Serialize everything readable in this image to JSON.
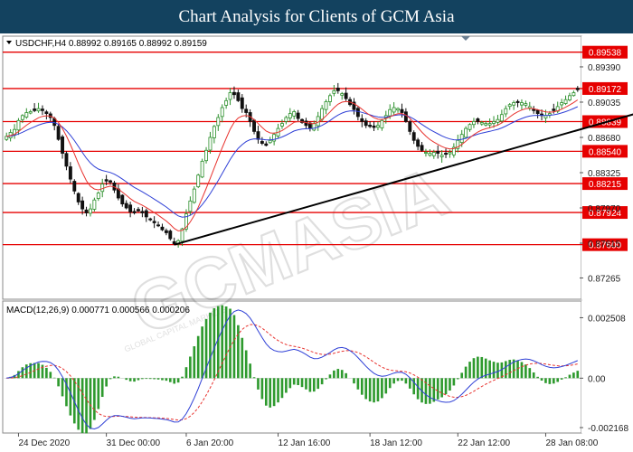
{
  "header": {
    "title": "Chart Analysis for Clients of GCM Asia"
  },
  "watermark": {
    "text": "GCMASIA",
    "subtext": "GLOBAL CAPITAL MARKETS"
  },
  "colors": {
    "title_bg": "#13425f",
    "bull": "#2b8f2b",
    "bear": "#111111",
    "level": "#e60000",
    "ma_red": "#e8332f",
    "ma_blue": "#2e3fd6",
    "trendline": "#000000",
    "macd_hist": "#2e9a2e",
    "macd_signal": "#e8332f",
    "macd_line": "#2e3fd6"
  },
  "chart_data": [
    {
      "type": "candlestick",
      "symbol_header": "USDCHF,H4  0.88992 0.89165 0.88992 0.89159",
      "ylim": [
        0.8706,
        0.8969
      ],
      "price_ticks": [
        "0.89390",
        "0.89035",
        "0.88680",
        "0.88325",
        "0.87970",
        "0.87615",
        "0.87265"
      ],
      "price_tick_values": [
        0.8939,
        0.89035,
        0.8868,
        0.88325,
        0.8797,
        0.87615,
        0.87265
      ],
      "levels": [
        {
          "label": "0.89538",
          "value": 0.89538
        },
        {
          "label": "0.89172",
          "value": 0.89172
        },
        {
          "label": "0.88839",
          "value": 0.88839
        },
        {
          "label": "0.88540",
          "value": 0.8854
        },
        {
          "label": "0.88215",
          "value": 0.88215
        },
        {
          "label": "0.87924",
          "value": 0.87924
        },
        {
          "label": "0.87600",
          "value": 0.876
        }
      ],
      "x_ticks": [
        "24 Dec 2020",
        "31 Dec 00:00",
        "6 Jan 20:00",
        "12 Jan 16:00",
        "18 Jan 12:00",
        "22 Jan 12:00",
        "28 Jan 08:00"
      ],
      "x_tick_index": [
        3,
        25,
        45,
        68,
        91,
        113,
        135
      ],
      "trendline": {
        "from": {
          "index": 42,
          "value": 0.876
        },
        "to": {
          "index": 162,
          "value": 0.8897
        }
      },
      "series": [
        {
          "name": "",
          "type": "candles",
          "close": [
            0.8869,
            0.8873,
            0.8876,
            0.8885,
            0.889,
            0.8893,
            0.8894,
            0.8895,
            0.8897,
            0.8895,
            0.8892,
            0.8888,
            0.888,
            0.8866,
            0.8852,
            0.8839,
            0.8826,
            0.8814,
            0.8803,
            0.8796,
            0.8792,
            0.8796,
            0.8805,
            0.8812,
            0.8821,
            0.8824,
            0.8823,
            0.8815,
            0.8807,
            0.8801,
            0.8797,
            0.8793,
            0.8792,
            0.8794,
            0.8792,
            0.8788,
            0.8785,
            0.8782,
            0.8779,
            0.8775,
            0.8772,
            0.8766,
            0.8761,
            0.8764,
            0.8776,
            0.8791,
            0.8804,
            0.8816,
            0.883,
            0.8844,
            0.8855,
            0.8868,
            0.8879,
            0.8888,
            0.8898,
            0.8905,
            0.8913,
            0.8911,
            0.8905,
            0.8897,
            0.8893,
            0.8884,
            0.8874,
            0.8866,
            0.8862,
            0.886,
            0.8865,
            0.8871,
            0.8877,
            0.8882,
            0.8888,
            0.8892,
            0.8894,
            0.8887,
            0.8883,
            0.888,
            0.8877,
            0.8882,
            0.8889,
            0.8897,
            0.8904,
            0.891,
            0.8915,
            0.8915,
            0.8912,
            0.8907,
            0.8901,
            0.8896,
            0.8889,
            0.8884,
            0.888,
            0.8879,
            0.8878,
            0.888,
            0.8885,
            0.889,
            0.8896,
            0.8898,
            0.8897,
            0.8893,
            0.8884,
            0.8874,
            0.8865,
            0.8859,
            0.8855,
            0.8853,
            0.8852,
            0.8853,
            0.8852,
            0.885,
            0.8851,
            0.8853,
            0.8858,
            0.8865,
            0.8871,
            0.8877,
            0.8881,
            0.8884,
            0.8884,
            0.8883,
            0.8882,
            0.8882,
            0.8884,
            0.8886,
            0.8891,
            0.8897,
            0.8901,
            0.8903,
            0.8903,
            0.8903,
            0.8902,
            0.8899,
            0.8895,
            0.8892,
            0.889,
            0.889,
            0.8892,
            0.8895,
            0.8899,
            0.8903,
            0.8906,
            0.891,
            0.8913,
            0.8916
          ]
        },
        {
          "name": "",
          "type": "ma",
          "period_hint": "fast"
        },
        {
          "name": "",
          "type": "ma",
          "period_hint": "slow"
        }
      ]
    },
    {
      "type": "line",
      "header": "MACD(12,26,9) 0.000771 0.000566 0.000206",
      "ylim": [
        -0.0022,
        0.0026
      ],
      "y_ticks": [
        "0.002508",
        "0.00",
        "-0.002168"
      ],
      "y_tick_values": [
        0.002508,
        0.0,
        -0.002168
      ],
      "series": [
        {
          "name": "",
          "type": "histogram"
        },
        {
          "name": "",
          "type": "signal"
        },
        {
          "name": "",
          "type": "macd"
        }
      ]
    }
  ]
}
